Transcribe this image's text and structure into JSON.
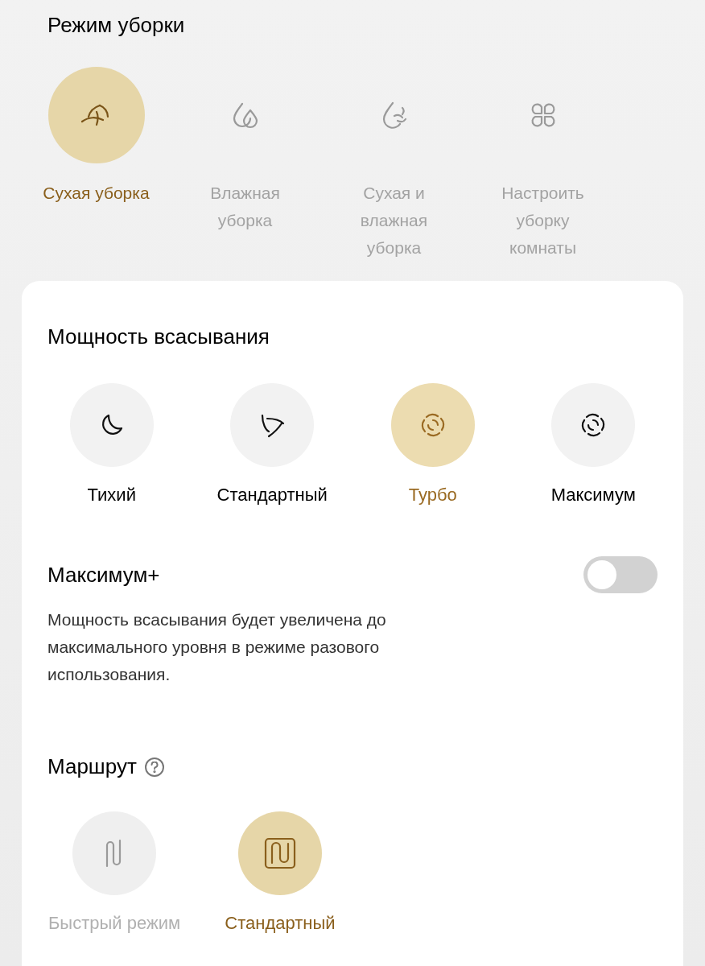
{
  "cleaning_mode": {
    "title": "Режим уборки",
    "options": [
      {
        "label": "Сухая уборка",
        "kind": "dry",
        "selected": true
      },
      {
        "label": "Влажная уборка",
        "kind": "wet",
        "selected": false
      },
      {
        "label": "Сухая и влажная уборка",
        "kind": "both",
        "selected": false
      },
      {
        "label": "Настроить уборку комнаты",
        "kind": "custom",
        "selected": false
      }
    ]
  },
  "suction_power": {
    "title": "Мощность всасывания",
    "options": [
      {
        "label": "Тихий",
        "kind": "quiet",
        "selected": false
      },
      {
        "label": "Стандартный",
        "kind": "standard",
        "selected": false
      },
      {
        "label": "Турбо",
        "kind": "turbo",
        "selected": true
      },
      {
        "label": "Максимум",
        "kind": "max",
        "selected": false
      }
    ]
  },
  "max_plus": {
    "title": "Максимум+",
    "on": false,
    "description": "Мощность всасывания будет увеличена до максимального уровня в режиме разового использования."
  },
  "route": {
    "title": "Маршрут",
    "options": [
      {
        "label": "Быстрый режим",
        "kind": "quick",
        "selected": false,
        "disabled": true
      },
      {
        "label": "Стандартный",
        "kind": "full",
        "selected": true,
        "disabled": false
      }
    ]
  }
}
